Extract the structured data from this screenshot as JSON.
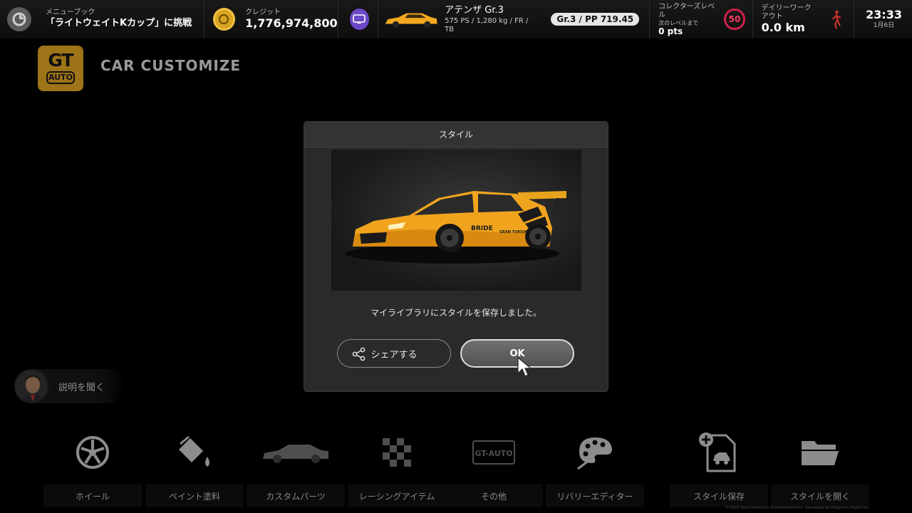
{
  "topbar": {
    "menu_book_label": "メニューブック",
    "menu_book_value": "「ライトウェイトKカップ」に挑戦",
    "credits_label": "クレジット",
    "credits_value": "1,776,974,800",
    "car_name": "アテンザ Gr.3",
    "car_specs": "575 PS / 1,280 kg / FR / TB",
    "pp_badge": "Gr.3 / PP 719.45",
    "collector_label": "コレクターズレベル",
    "collector_sub": "次のレベルまで",
    "collector_pts": "0 pts",
    "collector_level": "50",
    "workout_label": "デイリーワークアウト",
    "workout_value": "0.0 km",
    "clock_time": "23:33",
    "clock_date": "1月6日"
  },
  "header": {
    "logo_top": "GT",
    "logo_bottom": "AUTO",
    "title": "CAR CUSTOMIZE"
  },
  "help": {
    "label": "説明を聞く"
  },
  "modal": {
    "title": "スタイル",
    "message": "マイライブラリにスタイルを保存しました。",
    "share_label": "シェアする",
    "ok_label": "OK"
  },
  "car_decals": {
    "sponsor_1": "BRIDE",
    "sponsor_2": "GRAN TURISMO"
  },
  "menu": {
    "items": [
      {
        "label": "ホイール",
        "icon": "wheel-icon"
      },
      {
        "label": "ペイント塗料",
        "icon": "paint-bucket-icon"
      },
      {
        "label": "カスタムパーツ",
        "icon": "car-body-icon"
      },
      {
        "label": "レーシングアイテム",
        "icon": "checkered-flag-icon"
      },
      {
        "label": "その他",
        "icon": "gt-auto-plate-icon"
      },
      {
        "label": "リバリーエディター",
        "icon": "palette-icon"
      },
      {
        "label": "スタイル保存",
        "icon": "save-style-icon"
      },
      {
        "label": "スタイルを開く",
        "icon": "folder-icon"
      }
    ],
    "gt_plate_text": "GT-AUTO"
  },
  "footer": {
    "copyright": "© 2022 Sony Interactive Entertainment Inc. Developed by Polyphony Digital Inc."
  },
  "colors": {
    "accent_yellow": "#f2b326",
    "level_red": "#d0204a",
    "ticket_purple": "#6b48c8"
  }
}
